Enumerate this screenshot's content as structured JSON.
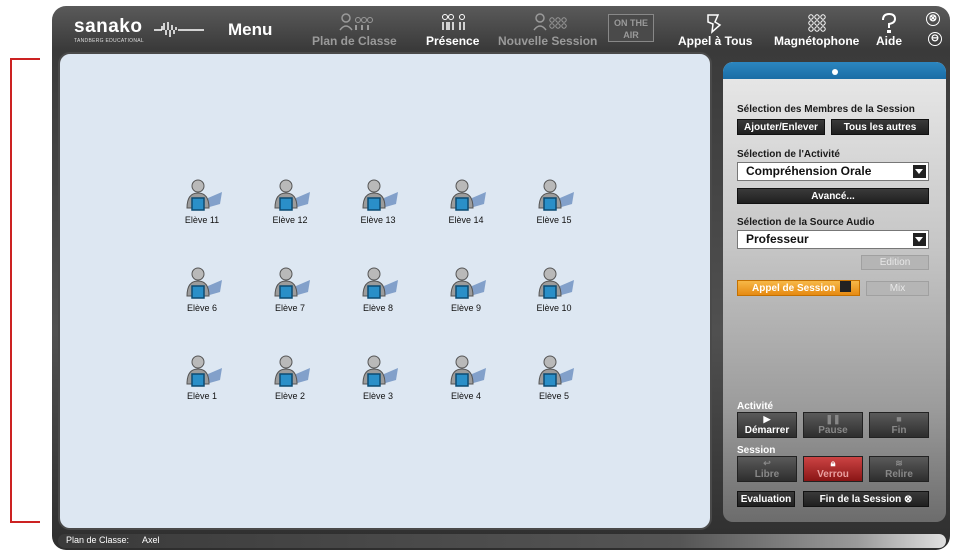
{
  "toolbar": {
    "logo_name": "sanako",
    "logo_sub": "TANDBERG EDUCATIONAL",
    "menu_label": "Menu",
    "plan_label": "Plan de Classe",
    "presence_label": "Présence",
    "nouvelle_session_label": "Nouvelle Session",
    "onair_line1": "ON THE",
    "onair_line2": "AIR",
    "appel_label": "Appel à Tous",
    "magneto_label": "Magnétophone",
    "aide_label": "Aide",
    "close_glyph": "⊗",
    "minimize_glyph": "⊖"
  },
  "classroom": {
    "students": [
      {
        "label": "Elève 11"
      },
      {
        "label": "Elève 12"
      },
      {
        "label": "Elève 13"
      },
      {
        "label": "Elève 14"
      },
      {
        "label": "Elève 15"
      },
      {
        "label": "Elève 6"
      },
      {
        "label": "Elève 7"
      },
      {
        "label": "Elève 8"
      },
      {
        "label": "Elève 9"
      },
      {
        "label": "Elève 10"
      },
      {
        "label": "Elève 1"
      },
      {
        "label": "Elève 2"
      },
      {
        "label": "Elève 3"
      },
      {
        "label": "Elève 4"
      },
      {
        "label": "Elève 5"
      }
    ]
  },
  "panel": {
    "members_title": "Sélection des Membres de la Session",
    "add_remove_label": "Ajouter/Enlever",
    "all_others_label": "Tous les autres",
    "activity_title": "Sélection de l'Activité",
    "activity_value": "Compréhension Orale",
    "advanced_label": "Avancé...",
    "audio_title": "Sélection de la Source Audio",
    "audio_value": "Professeur",
    "edition_label": "Edition",
    "session_call_label": "Appel de Session",
    "mix_label": "Mix",
    "activity_section": "Activité",
    "start_label": "Démarrer",
    "pause_label": "Pause",
    "end_label": "Fin",
    "session_section": "Session",
    "free_label": "Libre",
    "lock_label": "Verrou",
    "reread_label": "Relire",
    "evaluation_label": "Evaluation",
    "end_session_label": "Fin de la Session ⊗"
  },
  "status": {
    "label": "Plan de Classe:",
    "value": "Axel"
  },
  "colors": {
    "accent_blue": "#1b6da5",
    "classroom_bg": "#dde7f2",
    "orange": "#e68a12",
    "lock_red": "#8a1515"
  }
}
